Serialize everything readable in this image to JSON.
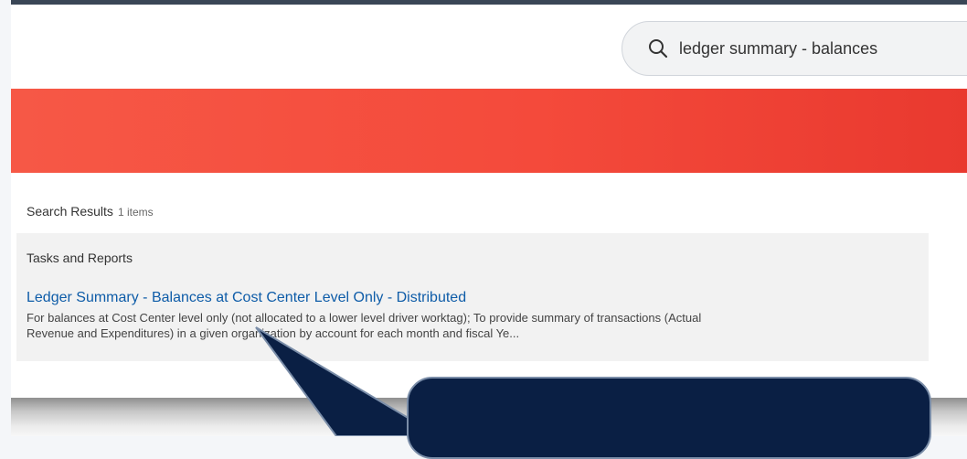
{
  "search": {
    "value": "ledger summary - balances",
    "icon": "search-icon"
  },
  "banner": {
    "color": "#f44a3b"
  },
  "results": {
    "heading": "Search Results",
    "count": "1 items",
    "section_title": "Tasks and Reports",
    "items": [
      {
        "title": "Ledger Summary - Balances at Cost Center Level Only - Distributed",
        "description_line1": "For balances at Cost Center level only (not allocated to a lower level driver worktag); To provide summary of transactions (Actual",
        "description_line2": "Revenue and Expenditures) in a given organization by account for each month and fiscal Ye..."
      }
    ]
  },
  "colors": {
    "link": "#0e5ca8",
    "callout": "#0a1f44",
    "banner": "#f44a3b"
  }
}
